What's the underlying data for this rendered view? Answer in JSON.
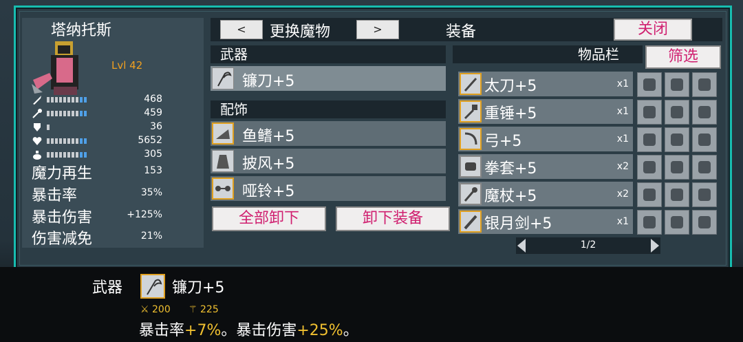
{
  "character": {
    "name": "塔纳托斯",
    "level": "Lvl 42",
    "stats": [
      {
        "icon": "sword-icon",
        "value": "468",
        "fill": 0.55
      },
      {
        "icon": "staff-icon",
        "value": "459",
        "fill": 0.55
      },
      {
        "icon": "shield-icon",
        "value": "36",
        "fill": 0.1
      },
      {
        "icon": "heart-icon",
        "value": "5652",
        "fill": 0.65
      },
      {
        "icon": "potion-icon",
        "value": "305",
        "fill": 0.6
      }
    ],
    "mana_regen": {
      "label": "魔力再生",
      "value": "153"
    },
    "crit_rate": {
      "label": "暴击率",
      "value": "35%"
    },
    "crit_damage": {
      "label": "暴击伤害",
      "value": "+125%"
    },
    "damage_reduction": {
      "label": "伤害减免",
      "value": "21%"
    }
  },
  "header": {
    "prev": "<",
    "switch_label": "更换魔物",
    "next": ">",
    "equip_label": "装备",
    "close_label": "关闭"
  },
  "equipment": {
    "weapon_header": "武器",
    "weapon": {
      "name": "镰刀+5",
      "icon": "scythe-icon"
    },
    "accessory_header": "配饰",
    "accessories": [
      {
        "name": "鱼鳍+5",
        "icon": "fin-icon"
      },
      {
        "name": "披风+5",
        "icon": "cloak-icon"
      },
      {
        "name": "哑铃+5",
        "icon": "dumbbell-icon"
      }
    ],
    "unequip_all": "全部卸下",
    "unequip": "卸下装备"
  },
  "inventory": {
    "header": "物品栏",
    "filter": "筛选",
    "items": [
      {
        "name": "太刀+5",
        "count": "x1",
        "icon": "katana-icon"
      },
      {
        "name": "重锤+5",
        "count": "x1",
        "icon": "hammer-icon"
      },
      {
        "name": "弓+5",
        "count": "x1",
        "icon": "bow-icon"
      },
      {
        "name": "拳套+5",
        "count": "x2",
        "icon": "gauntlet-icon"
      },
      {
        "name": "魔杖+5",
        "count": "x2",
        "icon": "wand-icon"
      },
      {
        "name": "银月剑+5",
        "count": "x1",
        "icon": "silver-moon-sword-icon"
      }
    ],
    "grid": [
      [
        "wand-icon",
        "wand-icon",
        "skull-icon"
      ],
      [
        "feather-icon",
        "glove-icon",
        "chain-icon"
      ],
      [
        "glove-icon",
        "wand-icon",
        "shuriken-icon"
      ],
      [
        "skull-icon",
        "shuriken-icon",
        "shuriken-icon"
      ],
      [
        "wand-icon",
        "feather-icon",
        "wand-icon"
      ],
      [
        "chain-icon",
        "wand-icon",
        "gauntlet-icon"
      ]
    ],
    "page": "1/2"
  },
  "tooltip": {
    "category": "武器",
    "name": "镰刀+5",
    "atk": "200",
    "matk": "225",
    "desc_a": "暴击率",
    "desc_b": "+7%",
    "desc_c": "。暴击伤害",
    "desc_d": "+25%",
    "desc_e": "。"
  },
  "colors": {
    "accent": "#17bdb0",
    "pink": "#d02070",
    "gold": "#e0a020"
  }
}
